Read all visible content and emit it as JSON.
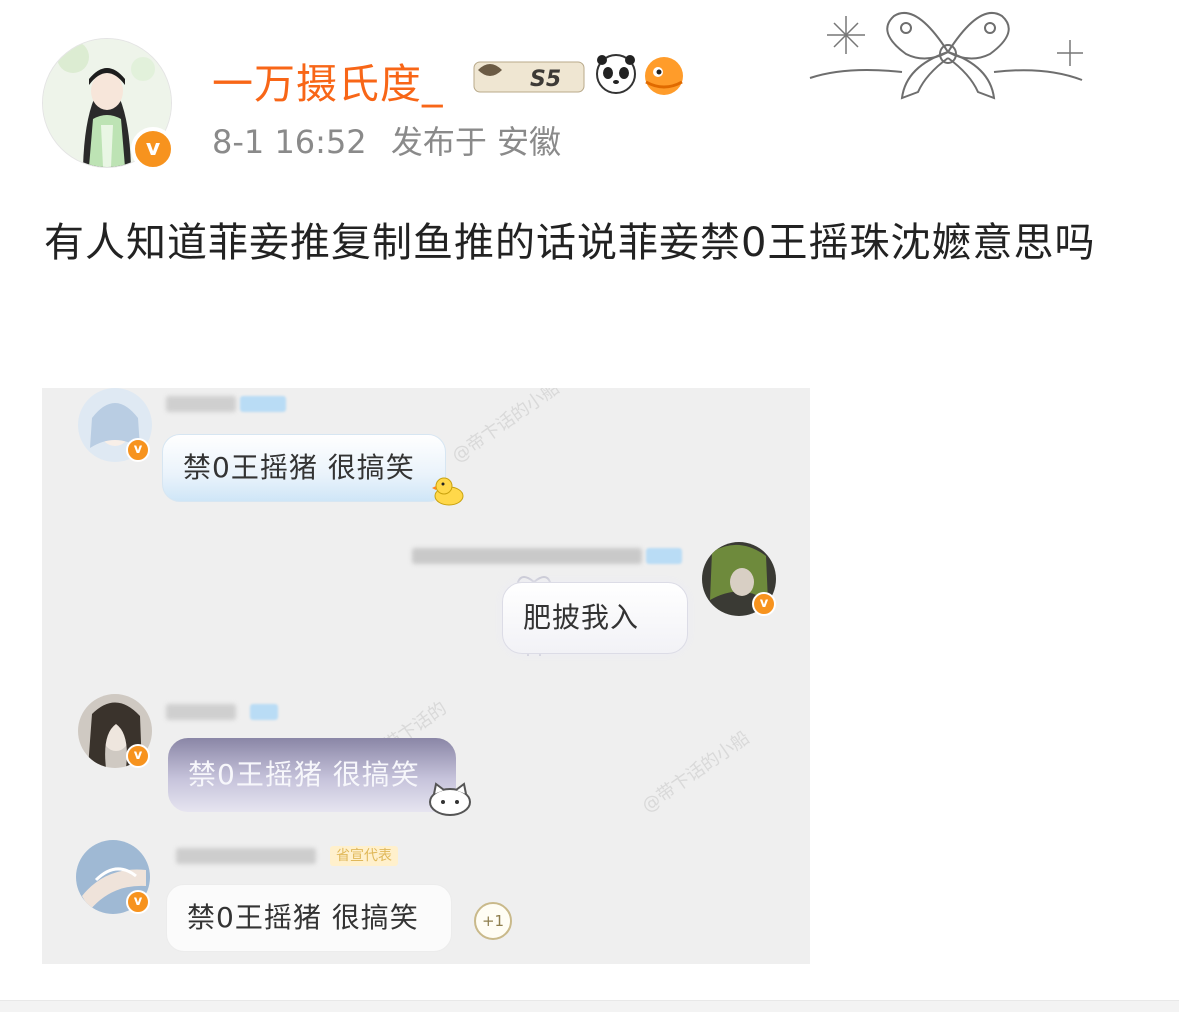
{
  "post": {
    "username": "一万摄氏度_",
    "time": "8-1 16:52",
    "location": "发布于 安徽",
    "verified_mark": "v",
    "badge_text": "S5",
    "text": "有人知道菲妾推复制鱼推的话说菲妾禁0王摇珠沈嬷意思吗"
  },
  "image": {
    "messages": [
      {
        "text": "禁0王摇猪 很搞笑"
      },
      {
        "text": "肥披我入"
      },
      {
        "text": "禁0王摇猪 很搞笑"
      },
      {
        "text": "禁0王摇猪 很搞笑"
      }
    ],
    "tag_label": "省宣代表",
    "reaction_count": "+1"
  },
  "colors": {
    "username": "#f86617",
    "verified": "#f7931e",
    "meta": "#8a8a8a"
  }
}
